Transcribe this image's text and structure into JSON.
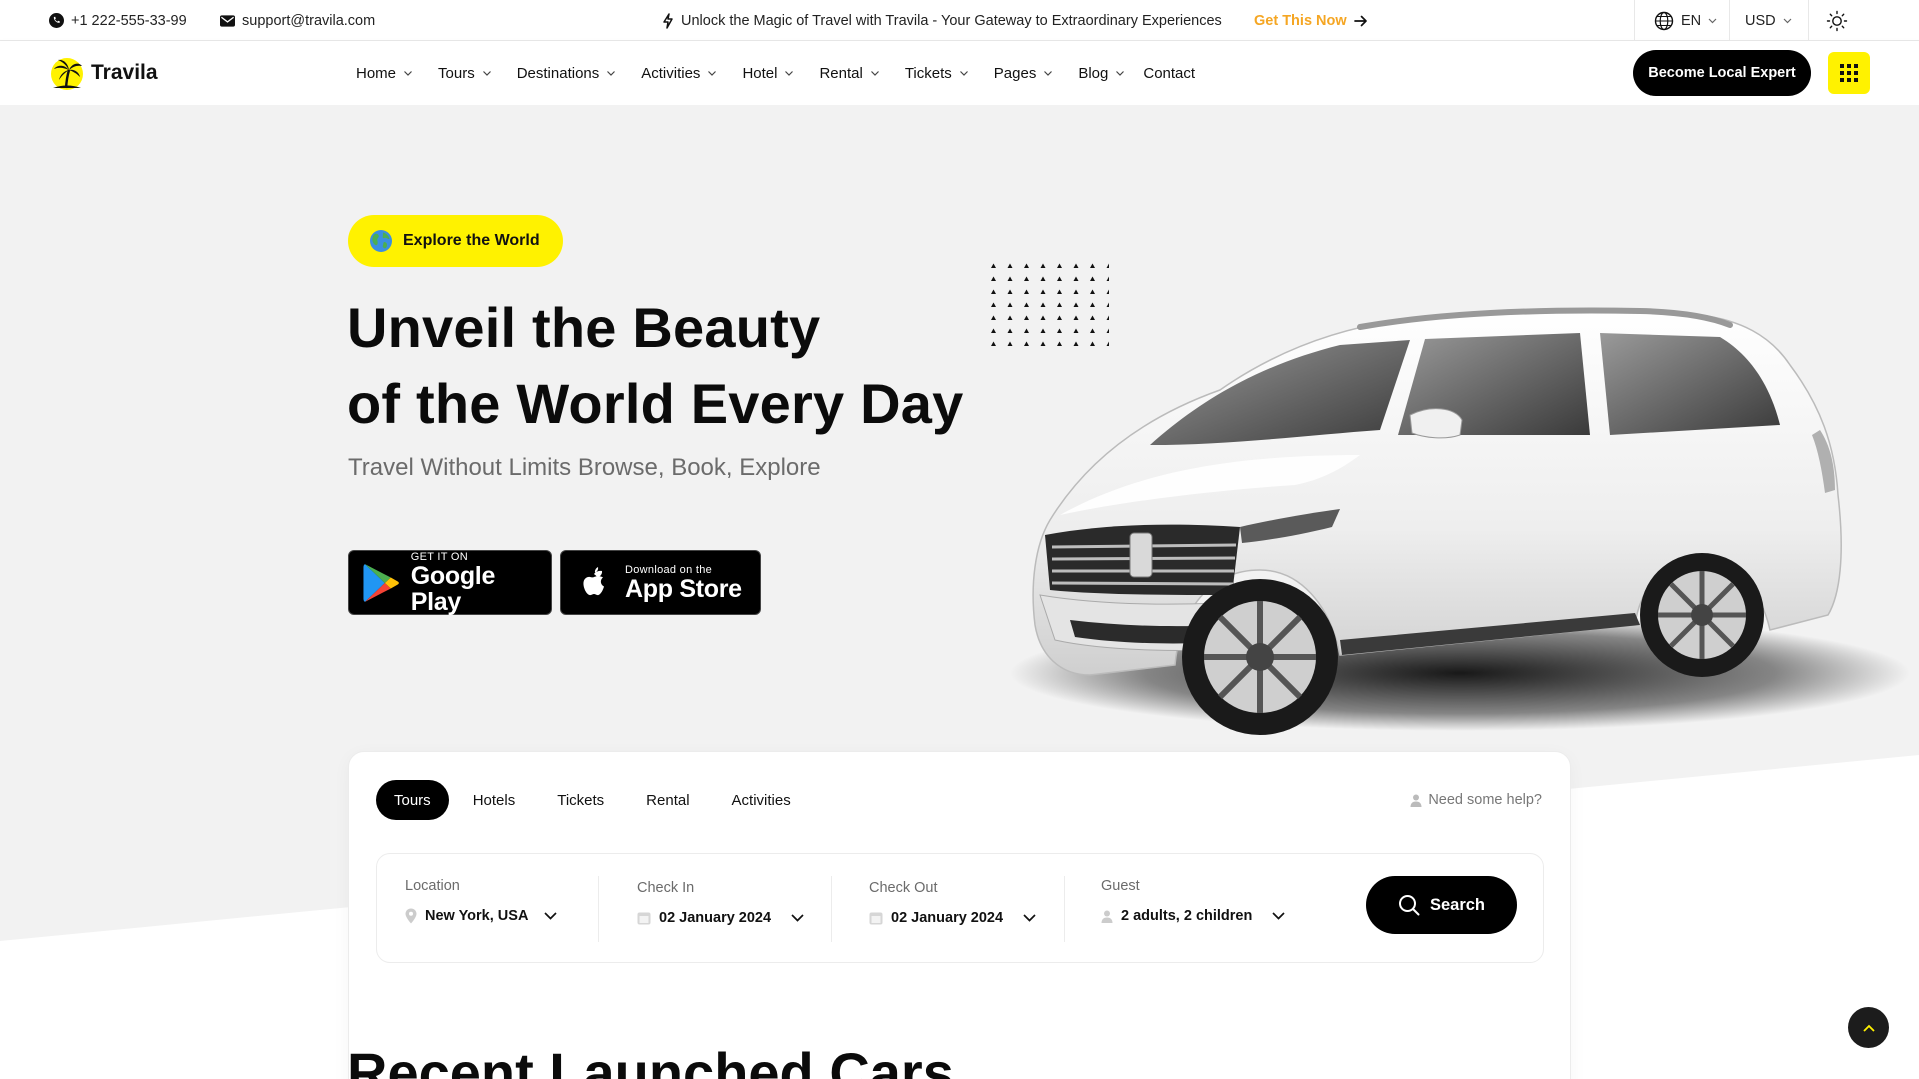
{
  "topbar": {
    "phone": "+1 222-555-33-99",
    "email": "support@travila.com",
    "promo": "Unlock the Magic of Travel with Travila - Your Gateway to Extraordinary Experiences",
    "promo_cta": "Get This Now",
    "language": "EN",
    "currency": "USD",
    "icons": [
      "phone-icon",
      "mail-icon",
      "lightning-icon",
      "arrow-right-icon",
      "globe-icon",
      "chevron-down-icon",
      "sun-icon"
    ]
  },
  "header": {
    "logo_text": "Travila",
    "nav": [
      {
        "label": "Home",
        "has_dropdown": true
      },
      {
        "label": "Tours",
        "has_dropdown": true
      },
      {
        "label": "Destinations",
        "has_dropdown": true
      },
      {
        "label": "Activities",
        "has_dropdown": true
      },
      {
        "label": "Hotel",
        "has_dropdown": true
      },
      {
        "label": "Rental",
        "has_dropdown": true
      },
      {
        "label": "Tickets",
        "has_dropdown": true
      },
      {
        "label": "Pages",
        "has_dropdown": true
      },
      {
        "label": "Blog",
        "has_dropdown": true
      },
      {
        "label": "Contact",
        "has_dropdown": false
      }
    ],
    "cta_label": "Become Local Expert",
    "menu_icon": "grid-menu-icon"
  },
  "hero": {
    "badge": "Explore the World",
    "title_line1": "Unveil the Beauty",
    "title_line2": "of the World Every Day",
    "subtitle": "Travel Without Limits Browse, Book, Explore",
    "google_play_small": "GET IT ON",
    "google_play_big": "Google Play",
    "app_store_small": "Download on the",
    "app_store_big": "App Store"
  },
  "search": {
    "tabs": [
      "Tours",
      "Hotels",
      "Tickets",
      "Rental",
      "Activities"
    ],
    "active_tab": "Tours",
    "help": "Need some help?",
    "location_label": "Location",
    "location_value": "New York, USA",
    "checkin_label": "Check In",
    "checkin_value": "02 January 2024",
    "checkout_label": "Check Out",
    "checkout_value": "02 January 2024",
    "guest_label": "Guest",
    "guest_value": "2 adults, 2 children",
    "button_label": "Search"
  },
  "section": {
    "title": "Recent Launched Cars"
  },
  "colors": {
    "accent_yellow": "#fff200",
    "cta_orange": "#f5a623",
    "hero_bg": "#f2f2f2",
    "dark": "#000000"
  }
}
